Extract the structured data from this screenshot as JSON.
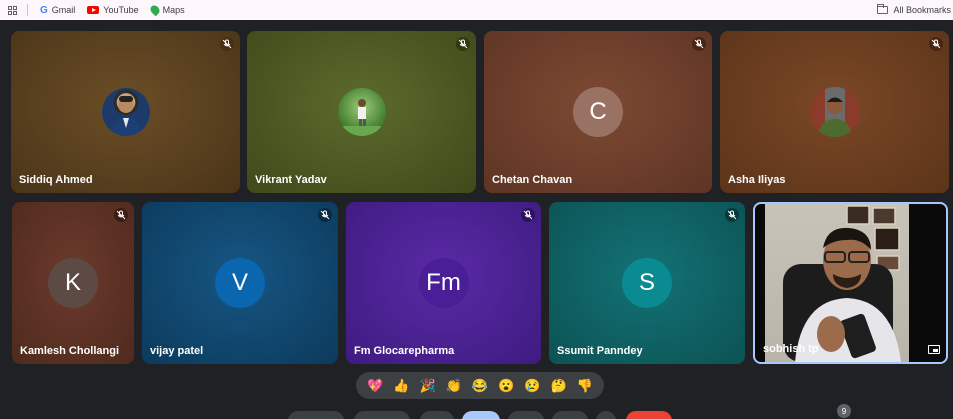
{
  "bookmarks": {
    "items": [
      {
        "label": "Gmail",
        "icon": "gmail-icon"
      },
      {
        "label": "YouTube",
        "icon": "youtube-icon"
      },
      {
        "label": "Maps",
        "icon": "maps-icon"
      }
    ],
    "all_bookmarks": "All Bookmarks"
  },
  "participants": [
    {
      "name": "Siddiq Ahmed",
      "avatar": "photo",
      "muted": true,
      "bg": "#5a3f1c"
    },
    {
      "name": "Vikrant Yadav",
      "avatar": "photo",
      "muted": true,
      "bg": "#4a5522"
    },
    {
      "name": "Chetan Chavan",
      "avatar": "C",
      "muted": true,
      "bg": "#6b3f2b"
    },
    {
      "name": "Asha Iliyas",
      "avatar": "photo",
      "muted": true,
      "bg": "#6d3e22"
    },
    {
      "name": "Kamlesh Chollangi",
      "avatar": "K",
      "muted": true,
      "bg": "#5a3024"
    },
    {
      "name": "vijay patel",
      "avatar": "V",
      "muted": true,
      "bg": "#0f4a74"
    },
    {
      "name": "Fm Glocarepharma",
      "avatar": "Fm",
      "muted": true,
      "bg": "#4d2394"
    },
    {
      "name": "Ssumit Panndey",
      "avatar": "S",
      "muted": true,
      "bg": "#0e6465"
    },
    {
      "name": "sobhish tp",
      "avatar": "video",
      "muted": false,
      "bg": "#1a1a1a"
    }
  ],
  "reactions": [
    "💖",
    "👍",
    "🎉",
    "👏",
    "😂",
    "😮",
    "😢",
    "🤔",
    "👎"
  ],
  "participant_count_badge": "9",
  "colors": {
    "background": "#202124",
    "reaction_bar": "#3c4043",
    "active_border": "#a8c7fa",
    "end_call": "#ea4335"
  }
}
